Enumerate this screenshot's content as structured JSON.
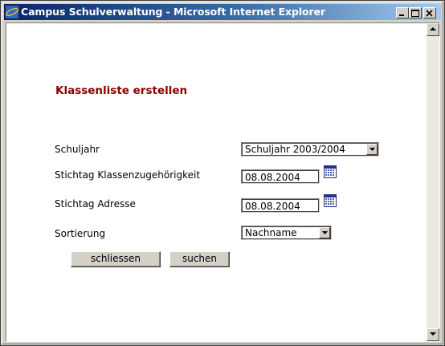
{
  "window": {
    "title": "Campus Schulverwaltung - Microsoft Internet Explorer",
    "icon": "internet-explorer-icon",
    "title_gradient": [
      "#0a246a",
      "#a6caf0"
    ]
  },
  "page": {
    "heading": "Klassenliste erstellen",
    "heading_color": "#8b0000"
  },
  "form": {
    "schuljahr": {
      "label": "Schuljahr",
      "value": "Schuljahr 2003/2004"
    },
    "stichtag_klasse": {
      "label": "Stichtag Klassenzugehörigkeit",
      "value": "08.08.2004",
      "icon": "calendar-icon"
    },
    "stichtag_adresse": {
      "label": "Stichtag Adresse",
      "value": "08.08.2004",
      "icon": "calendar-icon"
    },
    "sortierung": {
      "label": "Sortierung",
      "value": "Nachname"
    }
  },
  "buttons": {
    "close": "schliessen",
    "search": "suchen"
  }
}
